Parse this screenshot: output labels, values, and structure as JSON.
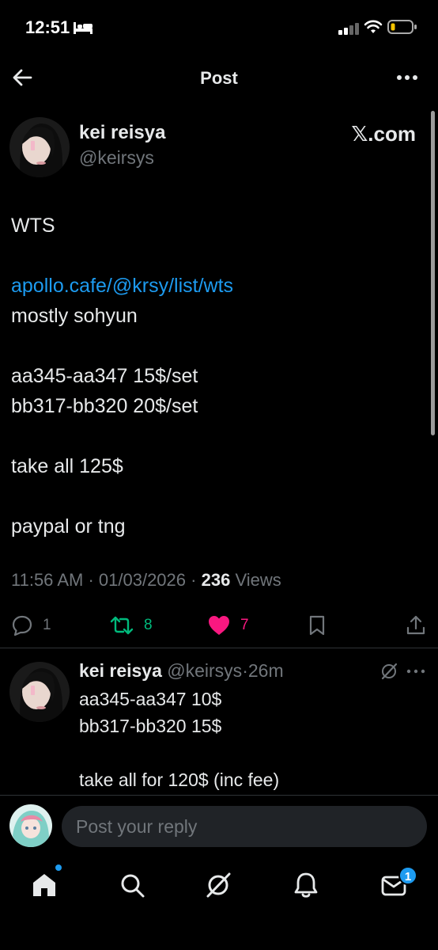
{
  "status_bar": {
    "time": "12:51"
  },
  "header": {
    "title": "Post"
  },
  "post": {
    "author_name": "kei reisya",
    "author_handle": "@keirsys",
    "source_label": "𝕏.com",
    "body_lines": [
      "WTS",
      "",
      "apollo.cafe/@krsy/list/wts",
      "mostly sohyun",
      "",
      "aa345-aa347 15$/set",
      "bb317-bb320 20$/set",
      "",
      "take all 125$",
      "",
      "paypal or tng"
    ],
    "link_text": "apollo.cafe/@krsy/list/wts",
    "time": "11:56 AM",
    "date": "01/03/2026",
    "views_count": "236",
    "views_label": "Views",
    "stats": {
      "replies": "1",
      "reposts": "8",
      "likes": "7"
    }
  },
  "reply": {
    "author_name": "kei reisya",
    "author_handle": "@keirsys",
    "age": "26m",
    "body_lines": [
      "aa345-aa347 10$",
      "bb317-bb320 15$",
      "",
      "take all for 120$ (inc fee)"
    ]
  },
  "composer": {
    "placeholder": "Post your reply"
  },
  "bottom_nav": {
    "items": [
      "home-icon",
      "search-icon",
      "grok-icon",
      "notifications-icon",
      "messages-icon"
    ],
    "messages_badge": "1"
  },
  "colors": {
    "accent": "#1d9bf0",
    "repost": "#00ba7c",
    "like": "#f91880",
    "muted": "#71767b"
  }
}
